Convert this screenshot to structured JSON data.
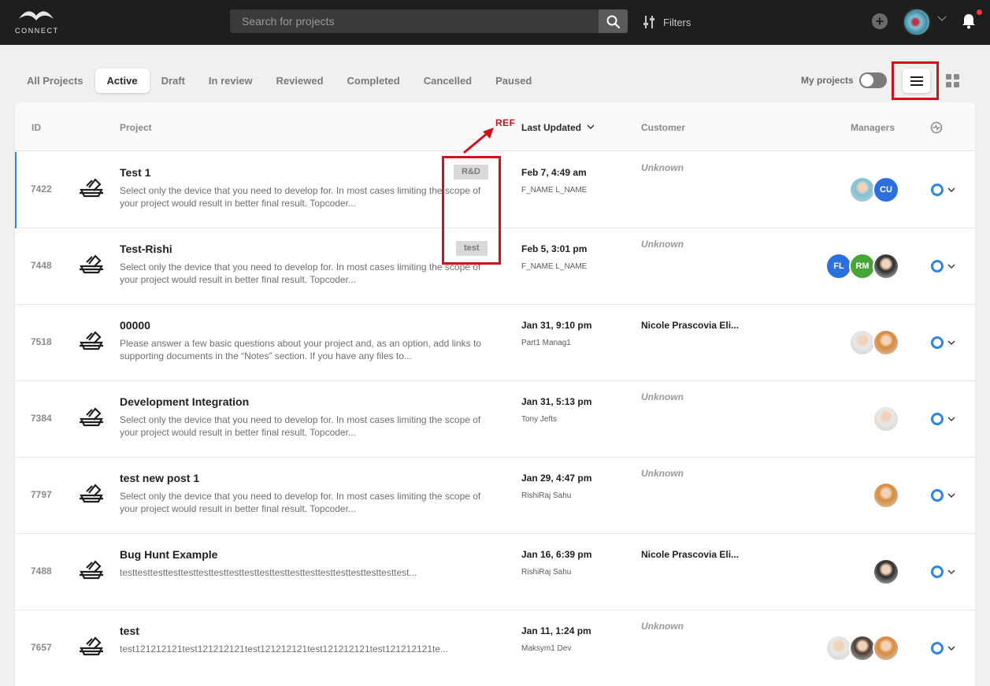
{
  "header": {
    "logo_text": "CONNECT",
    "search_placeholder": "Search for projects",
    "filters_label": "Filters",
    "add_label": "+"
  },
  "tabs": [
    {
      "label": "All Projects"
    },
    {
      "label": "Active"
    },
    {
      "label": "Draft"
    },
    {
      "label": "In review"
    },
    {
      "label": "Reviewed"
    },
    {
      "label": "Completed"
    },
    {
      "label": "Cancelled"
    },
    {
      "label": "Paused"
    }
  ],
  "active_tab": "Active",
  "my_projects_label": "My projects",
  "my_projects_on": false,
  "columns": {
    "id": "ID",
    "project": "Project",
    "last_updated": "Last Updated",
    "customer": "Customer",
    "managers": "Managers"
  },
  "annotation": {
    "label": "REF"
  },
  "rows": [
    {
      "id": "7422",
      "name": "Test 1",
      "desc": "Select only the device that you need to develop for. In most cases limiting the scope of your project would result in better final result. Topcoder...",
      "tag": "R&D",
      "date": "Feb 7, 4:49 am",
      "person": "F_NAME L_NAME",
      "customer": "Unknown",
      "customer_known": false,
      "managers": [
        {
          "kind": "photo",
          "color": "#7cc2d6"
        },
        {
          "kind": "initials",
          "text": "CU",
          "color": "#2e6fde"
        }
      ]
    },
    {
      "id": "7448",
      "name": "Test-Rishi",
      "desc": "Select only the device that you need to develop for. In most cases limiting the scope of your project would result in better final result. Topcoder...",
      "tag": "test",
      "date": "Feb 5, 3:01 pm",
      "person": "F_NAME L_NAME",
      "customer": "Unknown",
      "customer_known": false,
      "managers": [
        {
          "kind": "initials",
          "text": "FL",
          "color": "#2e6fde"
        },
        {
          "kind": "initials",
          "text": "RM",
          "color": "#47a538"
        },
        {
          "kind": "photo",
          "color": "#2b2b2b"
        }
      ]
    },
    {
      "id": "7518",
      "name": "00000",
      "desc": "Please answer a few basic questions about your project and, as an option, add links to supporting documents in the “Notes” section. If you have any files to...",
      "tag": "",
      "date": "Jan 31, 9:10 pm",
      "person": "Part1 Manag1",
      "customer": "Nicole Prascovia Eli...",
      "customer_known": true,
      "managers": [
        {
          "kind": "photo",
          "color": "#e8e8e8"
        },
        {
          "kind": "photo",
          "color": "#d98a3a"
        }
      ]
    },
    {
      "id": "7384",
      "name": "Development Integration",
      "desc": "Select only the device that you need to develop for. In most cases limiting the scope of your project would result in better final result. Topcoder...",
      "tag": "",
      "date": "Jan 31, 5:13 pm",
      "person": "Tony Jefts",
      "customer": "Unknown",
      "customer_known": false,
      "managers": [
        {
          "kind": "photo",
          "color": "#e8e8e8"
        }
      ]
    },
    {
      "id": "7797",
      "name": "test new post 1",
      "desc": "Select only the device that you need to develop for. In most cases limiting the scope of your project would result in better final result. Topcoder...",
      "tag": "",
      "date": "Jan 29, 4:47 pm",
      "person": "RishiRaj Sahu",
      "customer": "Unknown",
      "customer_known": false,
      "managers": [
        {
          "kind": "photo",
          "color": "#d98a3a"
        }
      ]
    },
    {
      "id": "7488",
      "name": "Bug Hunt Example",
      "desc": "testtesttesttesttesttesttesttesttesttesttesttesttesttesttesttesttesttesttest...",
      "tag": "",
      "date": "Jan 16, 6:39 pm",
      "person": "RishiRaj Sahu",
      "customer": "Nicole Prascovia Eli...",
      "customer_known": true,
      "managers": [
        {
          "kind": "photo",
          "color": "#2b2b2b"
        }
      ]
    },
    {
      "id": "7657",
      "name": "test",
      "desc": "test121212121test121212121test121212121test121212121test121212121te...",
      "tag": "",
      "date": "Jan 11, 1:24 pm",
      "person": "Maksym1 Dev",
      "customer": "Unknown",
      "customer_known": false,
      "managers": [
        {
          "kind": "photo",
          "color": "#e8e8e8"
        },
        {
          "kind": "photo",
          "color": "#4a3a30"
        },
        {
          "kind": "photo",
          "color": "#d98a3a"
        }
      ]
    }
  ],
  "colors": {
    "accent": "#2e86de",
    "annotation": "#d0111b",
    "topbar": "#1e1e1e"
  }
}
